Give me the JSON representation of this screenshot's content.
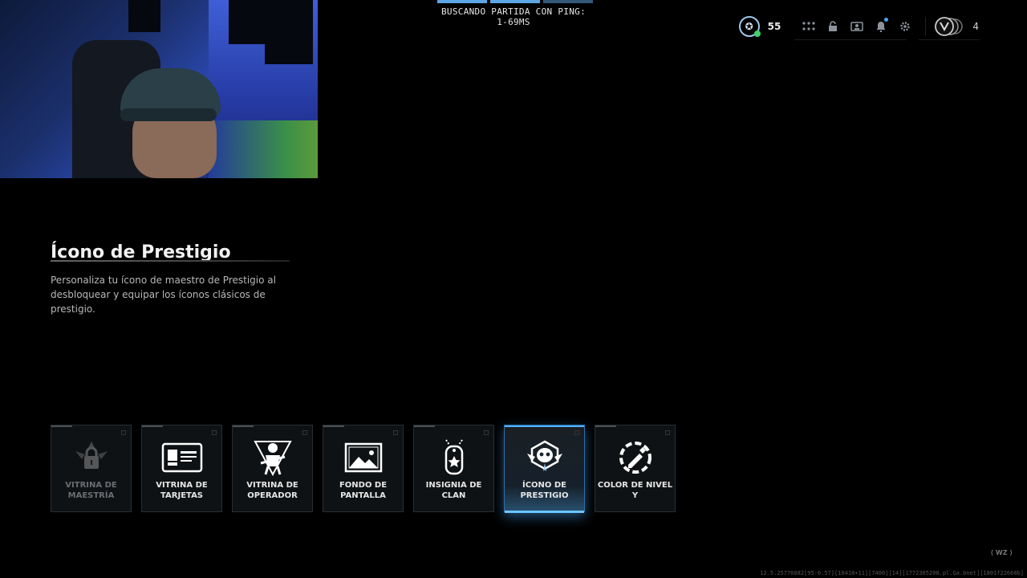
{
  "status": {
    "searching_text": "BUSCANDO PARTIDA CON PING: 1-69MS"
  },
  "topbar": {
    "rank_icon": "✪",
    "level": "55",
    "icons": [
      "party-grid-icon",
      "lock-open-icon",
      "id-card-icon",
      "bell-icon",
      "gear-icon"
    ],
    "prestige_count": "4"
  },
  "section": {
    "title": "Ícono de Prestigio",
    "description": "Personaliza tu ícono de maestro de Prestigio al desbloquear y equipar los íconos clásicos de prestigio."
  },
  "tiles": [
    {
      "label": "VITRINA DE MAESTRÍA",
      "icon": "lock-badge-icon",
      "state": "disabled"
    },
    {
      "label": "VITRINA DE TARJETAS",
      "icon": "id-card-icon",
      "state": "normal"
    },
    {
      "label": "VITRINA DE OPERADOR",
      "icon": "soldier-icon",
      "state": "normal"
    },
    {
      "label": "FONDO DE PANTALLA",
      "icon": "landscape-icon",
      "state": "normal"
    },
    {
      "label": "INSIGNIA DE CLAN",
      "icon": "dogtag-icon",
      "state": "normal"
    },
    {
      "label": "ÍCONO DE PRESTIGIO",
      "icon": "prestige-skull-icon",
      "state": "selected"
    },
    {
      "label": "COLOR DE NIVEL Y",
      "icon": "color-dropper-icon",
      "state": "normal"
    }
  ],
  "footer": {
    "build_info": "12.5.25776082[95-0.57][10418+11][7400][14][1772305208.pl.Ga.bnet][1801f22660b]",
    "logo": "⟨ WZ ⟩"
  },
  "colors": {
    "accent": "#4fb2ff",
    "online": "#3ed36a"
  }
}
